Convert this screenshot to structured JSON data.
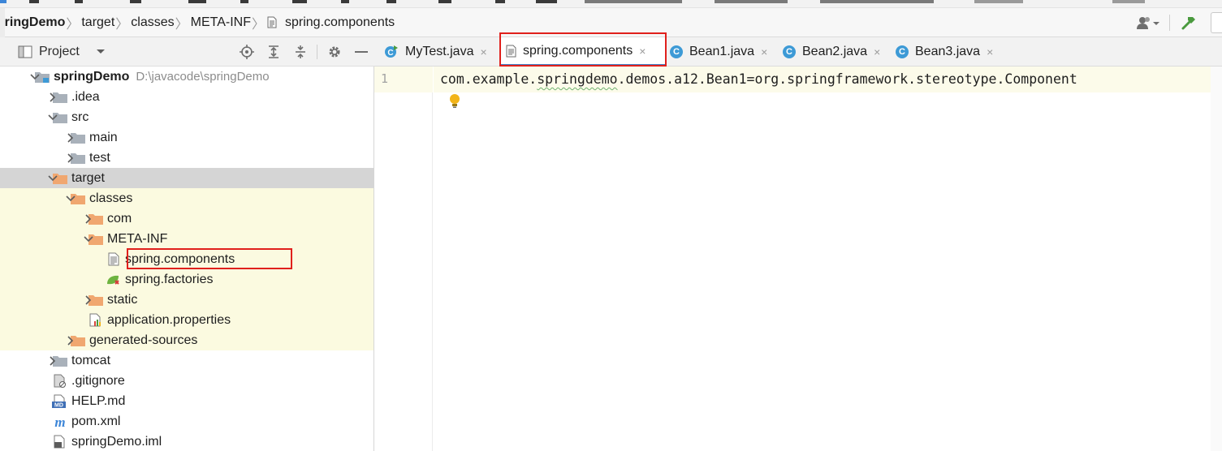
{
  "breadcrumb": {
    "items": [
      {
        "label": "springDemo",
        "bold": true
      },
      {
        "label": "target"
      },
      {
        "label": "classes"
      },
      {
        "label": "META-INF"
      },
      {
        "label": "spring.components",
        "icon": "text-file-icon"
      }
    ]
  },
  "toolbar_right": {
    "icons": [
      "user-dropdown-icon",
      "build-hammer-icon"
    ]
  },
  "project_panel": {
    "title": "Project",
    "header_icons": [
      "locate-icon",
      "expand-all-icon",
      "collapse-all-icon",
      "gear-icon",
      "hide-icon"
    ]
  },
  "tree": [
    {
      "label": "springDemo",
      "path": "D:\\javacode\\springDemo",
      "depth": 0,
      "arrow": "down",
      "icon": "module-folder-icon",
      "bold": true
    },
    {
      "label": ".idea",
      "depth": 1,
      "arrow": "right",
      "icon": "folder-grey-icon"
    },
    {
      "label": "src",
      "depth": 1,
      "arrow": "down",
      "icon": "folder-grey-icon"
    },
    {
      "label": "main",
      "depth": 2,
      "arrow": "right",
      "icon": "folder-grey-icon"
    },
    {
      "label": "test",
      "depth": 2,
      "arrow": "right",
      "icon": "folder-grey-icon"
    },
    {
      "label": "target",
      "depth": 1,
      "arrow": "down",
      "icon": "folder-orange-icon",
      "selected": true
    },
    {
      "label": "classes",
      "depth": 2,
      "arrow": "down",
      "icon": "folder-orange-icon",
      "highlight": true
    },
    {
      "label": "com",
      "depth": 3,
      "arrow": "right",
      "icon": "folder-orange-icon",
      "highlight": true
    },
    {
      "label": "META-INF",
      "depth": 3,
      "arrow": "down",
      "icon": "folder-orange-icon",
      "highlight": true
    },
    {
      "label": "spring.components",
      "depth": 4,
      "arrow": "none",
      "icon": "text-file-icon",
      "highlight": true,
      "boxed": true
    },
    {
      "label": "spring.factories",
      "depth": 4,
      "arrow": "none",
      "icon": "spring-leaf-icon",
      "highlight": true
    },
    {
      "label": "static",
      "depth": 3,
      "arrow": "right",
      "icon": "folder-orange-icon",
      "highlight": true
    },
    {
      "label": "application.properties",
      "depth": 3,
      "arrow": "none",
      "icon": "properties-file-icon",
      "highlight": true
    },
    {
      "label": "generated-sources",
      "depth": 2,
      "arrow": "right",
      "icon": "folder-orange-icon",
      "highlight": true
    },
    {
      "label": "tomcat",
      "depth": 1,
      "arrow": "right",
      "icon": "folder-grey-icon"
    },
    {
      "label": ".gitignore",
      "depth": 1,
      "arrow": "none",
      "icon": "gitignore-file-icon"
    },
    {
      "label": "HELP.md",
      "depth": 1,
      "arrow": "none",
      "icon": "markdown-file-icon"
    },
    {
      "label": "pom.xml",
      "depth": 1,
      "arrow": "none",
      "icon": "maven-file-icon"
    },
    {
      "label": "springDemo.iml",
      "depth": 1,
      "arrow": "none",
      "icon": "iml-file-icon"
    }
  ],
  "editor": {
    "tabs": [
      {
        "label": "MyTest.java",
        "icon": "java-test-class-icon",
        "close": "×"
      },
      {
        "label": "spring.components",
        "icon": "text-file-icon",
        "close": "×",
        "active": true
      },
      {
        "label": "Bean1.java",
        "icon": "java-class-icon",
        "close": "×"
      },
      {
        "label": "Bean2.java",
        "icon": "java-class-icon",
        "close": "×"
      },
      {
        "label": "Bean3.java",
        "icon": "java-class-icon",
        "close": "×"
      }
    ],
    "line_number": "1",
    "code_prefix": "com.example.",
    "code_squiggle": "springdemo",
    "code_suffix": ".demos.a12.Bean1=org.springframework.stereotype.Component"
  },
  "colors": {
    "selection_bg": "#d5d5d5",
    "highlight_bg": "#fbfae0",
    "annotation_box": "#e0201c",
    "folder_grey": "#a9b1ba",
    "folder_orange": "#f0a770",
    "java_class_badge": "#3d9ad6"
  }
}
